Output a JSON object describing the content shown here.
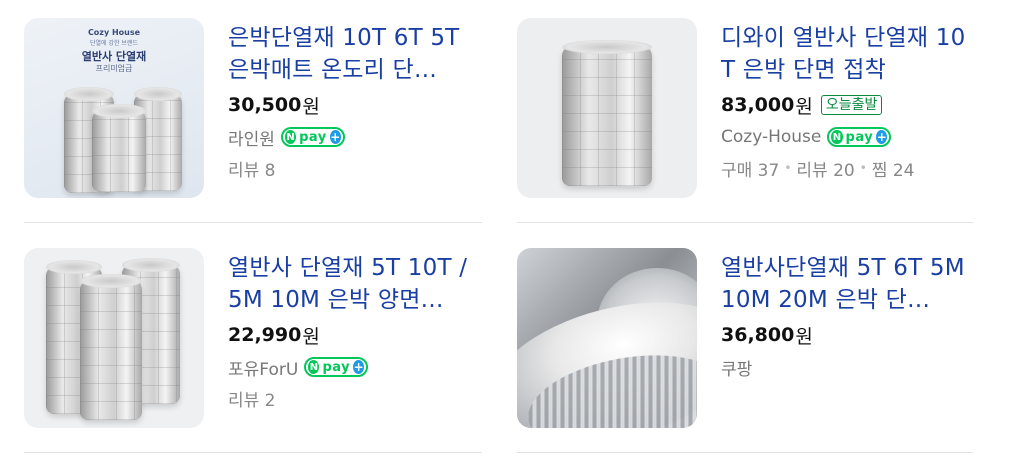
{
  "products": [
    {
      "title": "은박단열재 10T 6T 5T 은박매트 온도리 단…",
      "price": "30,500",
      "currency": "원",
      "seller": "라인원",
      "npay": true,
      "meta": [
        "리뷰 8"
      ],
      "image": {
        "brand": "Cozy House",
        "tagline": "단열에 강한 브랜드",
        "label": "열반사 단열재",
        "sublabel": "프리미엄급"
      }
    },
    {
      "title": "디와이 열반사 단열재 10T 은박 단면 접착",
      "price": "83,000",
      "currency": "원",
      "badge": "오늘출발",
      "seller": "Cozy-House",
      "npay": true,
      "meta": [
        "구매 37",
        "리뷰 20",
        "찜 24"
      ]
    },
    {
      "title": "열반사 단열재 5T 10T / 5M 10M 은박 양면…",
      "price": "22,990",
      "currency": "원",
      "seller": "포유ForU",
      "npay": true,
      "meta": [
        "리뷰 2"
      ]
    },
    {
      "title": "열반사단열재 5T 6T 5M 10M 20M 은박 단…",
      "price": "36,800",
      "currency": "원",
      "seller": "쿠팡",
      "npay": false,
      "meta": []
    }
  ],
  "npay_badge": {
    "n": "N",
    "pay": "pay",
    "plus": "+"
  },
  "colors": {
    "title": "#1a3fa3",
    "npay_green": "#03c75a",
    "badge_green": "#0a8a3d"
  }
}
